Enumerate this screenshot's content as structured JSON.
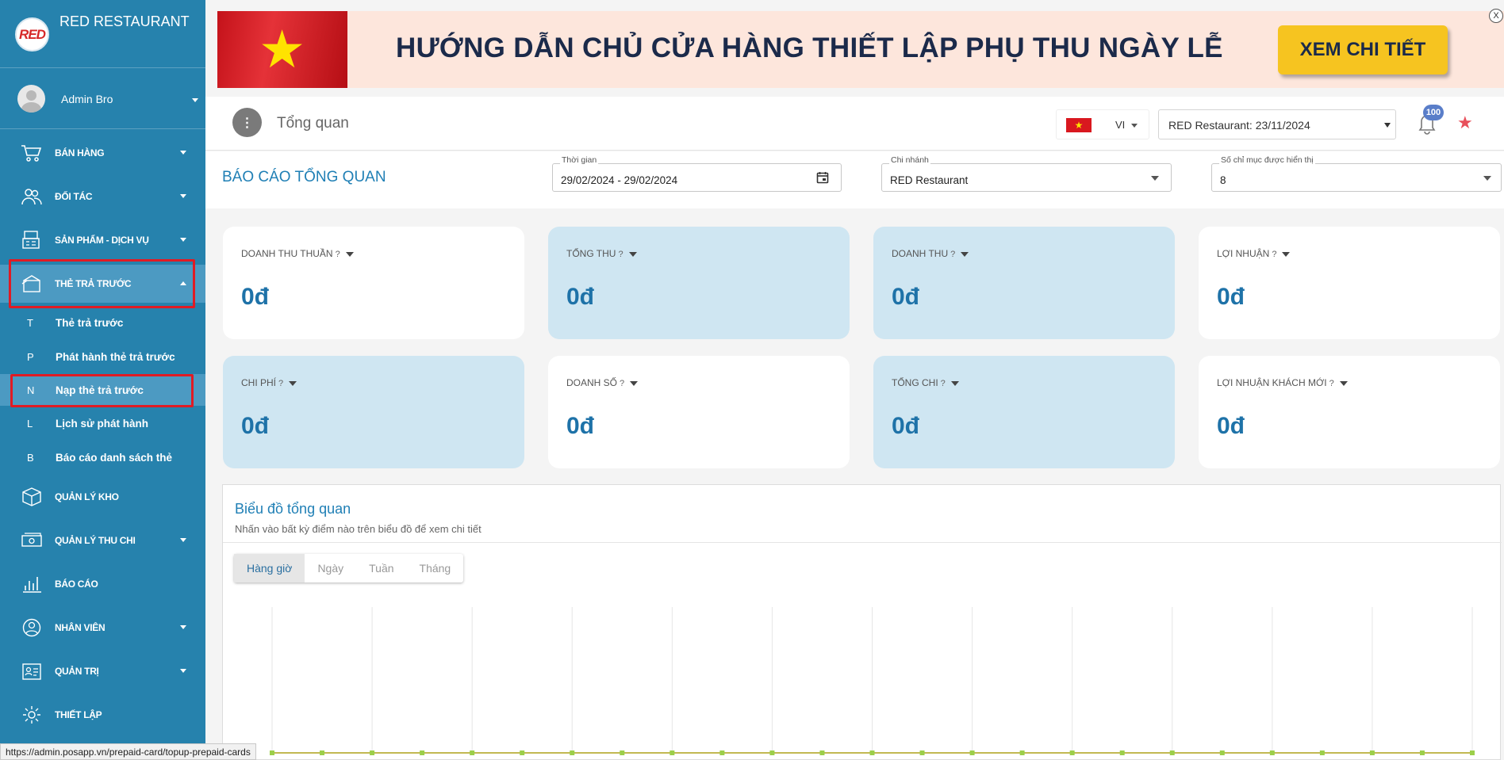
{
  "brand": {
    "title": "RED RESTAURANT",
    "logo_text": "RED"
  },
  "user": {
    "name": "Admin Bro"
  },
  "sidebar": {
    "items": [
      {
        "label": "BÁN HÀNG",
        "icon": "cart-icon"
      },
      {
        "label": "ĐỐI TÁC",
        "icon": "users-icon"
      },
      {
        "label": "SẢN PHẨM - DỊCH VỤ",
        "icon": "register-icon"
      },
      {
        "label": "THẺ TRẢ TRƯỚC",
        "icon": "card-icon"
      },
      {
        "label": "QUẢN LÝ KHO",
        "icon": "box-icon"
      },
      {
        "label": "QUẢN LÝ THU CHI",
        "icon": "money-icon"
      },
      {
        "label": "BÁO CÁO",
        "icon": "bar-chart-icon"
      },
      {
        "label": "NHÂN VIÊN",
        "icon": "person-icon"
      },
      {
        "label": "QUẢN TRỊ",
        "icon": "id-card-icon"
      },
      {
        "label": "THIẾT LẬP",
        "icon": "gear-icon"
      }
    ],
    "subitems": [
      {
        "letter": "T",
        "label": "Thẻ trả trước"
      },
      {
        "letter": "P",
        "label": "Phát hành thẻ trả trước"
      },
      {
        "letter": "N",
        "label": "Nạp thẻ trả trước"
      },
      {
        "letter": "L",
        "label": "Lịch sử phát hành"
      },
      {
        "letter": "B",
        "label": "Báo cáo danh sách thẻ"
      }
    ]
  },
  "banner": {
    "text": "HƯỚNG DẪN CHỦ CỬA HÀNG THIẾT LẬP PHỤ THU NGÀY LỄ",
    "button": "XEM CHI TIẾT",
    "close": "X",
    "flag_star": "★"
  },
  "topbar": {
    "menu_glyph": "⋮",
    "title": "Tổng quan",
    "lang": "VI",
    "store": "RED Restaurant: 23/11/2024",
    "notifications": "100",
    "star_glyph": "★"
  },
  "report": {
    "title": "BÁO CÁO TỔNG QUAN",
    "time_label": "Thời gian",
    "time_value": "29/02/2024 - 29/02/2024",
    "branch_label": "Chi nhánh",
    "branch_value": "RED Restaurant",
    "count_label": "Số chỉ mục được hiển thị",
    "count_value": "8"
  },
  "cards": [
    {
      "label": "DOANH THU THUẦN",
      "value": "0đ"
    },
    {
      "label": "TỔNG THU",
      "value": "0đ"
    },
    {
      "label": "DOANH THU",
      "value": "0đ"
    },
    {
      "label": "LỢI NHUẬN",
      "value": "0đ"
    },
    {
      "label": "CHI PHÍ",
      "value": "0đ"
    },
    {
      "label": "DOANH SỐ",
      "value": "0đ"
    },
    {
      "label": "TỔNG CHI",
      "value": "0đ"
    },
    {
      "label": "LỢI NHUẬN KHÁCH MỚI",
      "value": "0đ"
    }
  ],
  "help_glyph": "?",
  "chart": {
    "title": "Biểu đồ tổng quan",
    "subtitle": "Nhấn vào bất kỳ điểm nào trên biểu đồ để xem chi tiết",
    "tabs": [
      "Hàng giờ",
      "Ngày",
      "Tuần",
      "Tháng"
    ]
  },
  "chart_data": {
    "type": "line",
    "points_count": 24,
    "values": [
      0,
      0,
      0,
      0,
      0,
      0,
      0,
      0,
      0,
      0,
      0,
      0,
      0,
      0,
      0,
      0,
      0,
      0,
      0,
      0,
      0,
      0,
      0,
      0,
      0
    ],
    "series_colors": [
      "#e8a05b",
      "#9ccf4a"
    ]
  },
  "status_bar": {
    "url": "https://admin.posapp.vn/prepaid-card/topup-prepaid-cards"
  },
  "colors": {
    "sidebar": "#2682ad",
    "accent": "#1f7fb5",
    "highlight": "#e01b24"
  }
}
